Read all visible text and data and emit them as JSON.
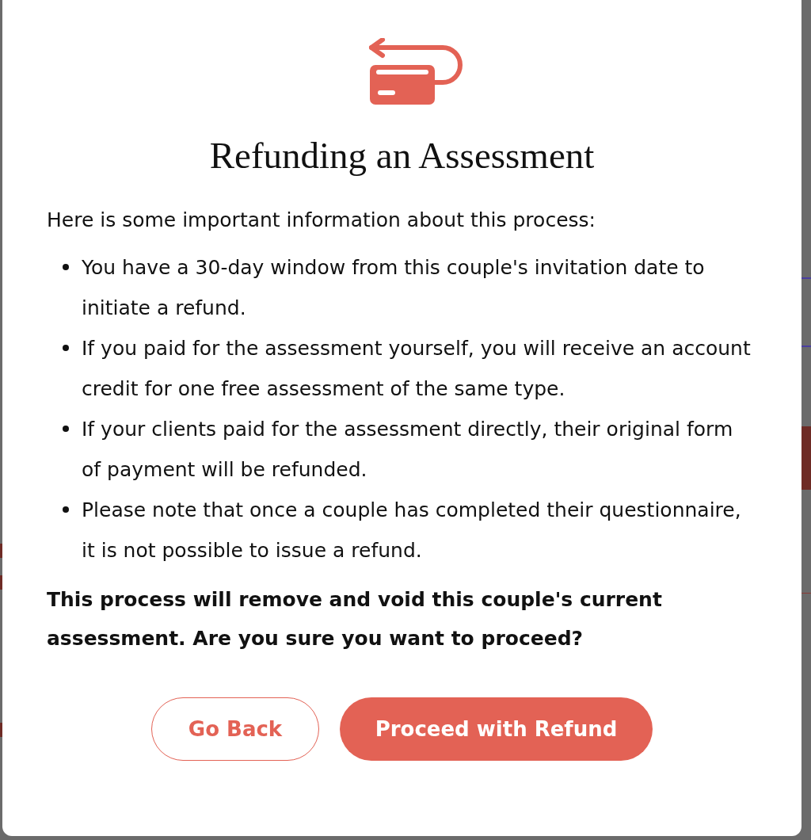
{
  "dialog": {
    "title": "Refunding an Assessment",
    "intro": "Here is some important information about this process:",
    "points": [
      "You have a 30-day window from this couple's invitation date to initiate a refund.",
      "If you paid for the assessment yourself, you will receive an account credit for one free assessment of the same type.",
      "If your clients paid for the assessment directly, their original form of payment will be refunded.",
      "Please note that once a couple has completed their questionnaire, it is not possible to issue a refund."
    ],
    "warning": "This process will remove and void this couple's current assessment. Are you sure you want to proceed?",
    "buttons": [
      {
        "label": "Go Back",
        "kind": "secondary"
      },
      {
        "label": "Proceed with Refund",
        "kind": "primary"
      }
    ]
  }
}
